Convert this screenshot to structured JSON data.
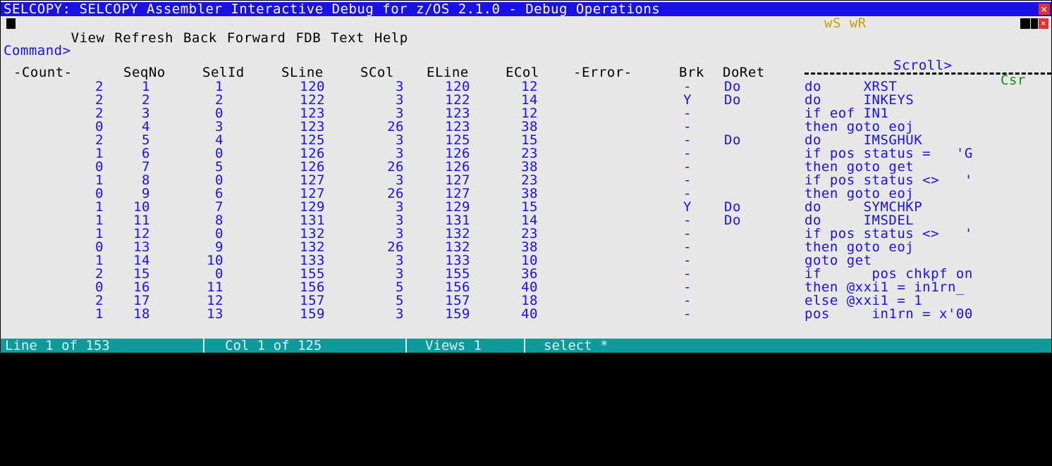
{
  "title": "SELCOPY: SELCOPY Assembler Interactive Debug for z/OS 2.1.0 - Debug Operations",
  "menu": [
    "View",
    "Refresh",
    "Back",
    "Forward",
    "FDB",
    "Text",
    "Help"
  ],
  "indicators": "wS wR",
  "command_label": "Command>",
  "scroll_label": "Scroll>",
  "scroll_value": "Csr",
  "columns": [
    "-Count-",
    "SeqNo",
    "SelId",
    "SLine",
    "SCol",
    "ELine",
    "ECol",
    "-Error-",
    "Brk",
    "DoRet"
  ],
  "rows": [
    {
      "count": "2",
      "seq": "1",
      "sel": "1",
      "sline": "120",
      "scol": "3",
      "eline": "120",
      "ecol": "12",
      "brk": "-",
      "doret": "Do",
      "text": "do     XRST"
    },
    {
      "count": "2",
      "seq": "2",
      "sel": "2",
      "sline": "122",
      "scol": "3",
      "eline": "122",
      "ecol": "14",
      "brk": "Y",
      "doret": "Do",
      "text": "do     INKEYS"
    },
    {
      "count": "2",
      "seq": "3",
      "sel": "0",
      "sline": "123",
      "scol": "3",
      "eline": "123",
      "ecol": "12",
      "brk": "-",
      "doret": "",
      "text": "if eof IN1"
    },
    {
      "count": "0",
      "seq": "4",
      "sel": "3",
      "sline": "123",
      "scol": "26",
      "eline": "123",
      "ecol": "38",
      "brk": "-",
      "doret": "",
      "text": "then goto eoj"
    },
    {
      "count": "2",
      "seq": "5",
      "sel": "4",
      "sline": "125",
      "scol": "3",
      "eline": "125",
      "ecol": "15",
      "brk": "-",
      "doret": "Do",
      "text": "do     IMSGHUK"
    },
    {
      "count": "1",
      "seq": "6",
      "sel": "0",
      "sline": "126",
      "scol": "3",
      "eline": "126",
      "ecol": "23",
      "brk": "-",
      "doret": "",
      "text": "if pos status =   'G"
    },
    {
      "count": "0",
      "seq": "7",
      "sel": "5",
      "sline": "126",
      "scol": "26",
      "eline": "126",
      "ecol": "38",
      "brk": "-",
      "doret": "",
      "text": "then goto get"
    },
    {
      "count": "1",
      "seq": "8",
      "sel": "0",
      "sline": "127",
      "scol": "3",
      "eline": "127",
      "ecol": "23",
      "brk": "-",
      "doret": "",
      "text": "if pos status <>   '"
    },
    {
      "count": "0",
      "seq": "9",
      "sel": "6",
      "sline": "127",
      "scol": "26",
      "eline": "127",
      "ecol": "38",
      "brk": "-",
      "doret": "",
      "text": "then goto eoj"
    },
    {
      "count": "1",
      "seq": "10",
      "sel": "7",
      "sline": "129",
      "scol": "3",
      "eline": "129",
      "ecol": "15",
      "brk": "Y",
      "doret": "Do",
      "text": "do     SYMCHKP"
    },
    {
      "count": "1",
      "seq": "11",
      "sel": "8",
      "sline": "131",
      "scol": "3",
      "eline": "131",
      "ecol": "14",
      "brk": "-",
      "doret": "Do",
      "text": "do     IMSDEL"
    },
    {
      "count": "1",
      "seq": "12",
      "sel": "0",
      "sline": "132",
      "scol": "3",
      "eline": "132",
      "ecol": "23",
      "brk": "-",
      "doret": "",
      "text": "if pos status <>   '"
    },
    {
      "count": "0",
      "seq": "13",
      "sel": "9",
      "sline": "132",
      "scol": "26",
      "eline": "132",
      "ecol": "38",
      "brk": "-",
      "doret": "",
      "text": "then goto eoj"
    },
    {
      "count": "1",
      "seq": "14",
      "sel": "10",
      "sline": "133",
      "scol": "3",
      "eline": "133",
      "ecol": "10",
      "brk": "-",
      "doret": "",
      "text": "goto get"
    },
    {
      "count": "2",
      "seq": "15",
      "sel": "0",
      "sline": "155",
      "scol": "3",
      "eline": "155",
      "ecol": "36",
      "brk": "-",
      "doret": "",
      "text": "if      pos chkpf on"
    },
    {
      "count": "0",
      "seq": "16",
      "sel": "11",
      "sline": "156",
      "scol": "5",
      "eline": "156",
      "ecol": "40",
      "brk": "-",
      "doret": "",
      "text": "then @xxi1 = in1rn_"
    },
    {
      "count": "2",
      "seq": "17",
      "sel": "12",
      "sline": "157",
      "scol": "5",
      "eline": "157",
      "ecol": "18",
      "brk": "-",
      "doret": "",
      "text": "else @xxi1 = 1"
    },
    {
      "count": "1",
      "seq": "18",
      "sel": "13",
      "sline": "159",
      "scol": "3",
      "eline": "159",
      "ecol": "40",
      "brk": "-",
      "doret": "",
      "text": "pos     in1rn = x'00"
    }
  ],
  "status": {
    "line": "Line 1 of 153",
    "col": "Col 1 of 125",
    "views": "Views 1",
    "select": "select *"
  }
}
